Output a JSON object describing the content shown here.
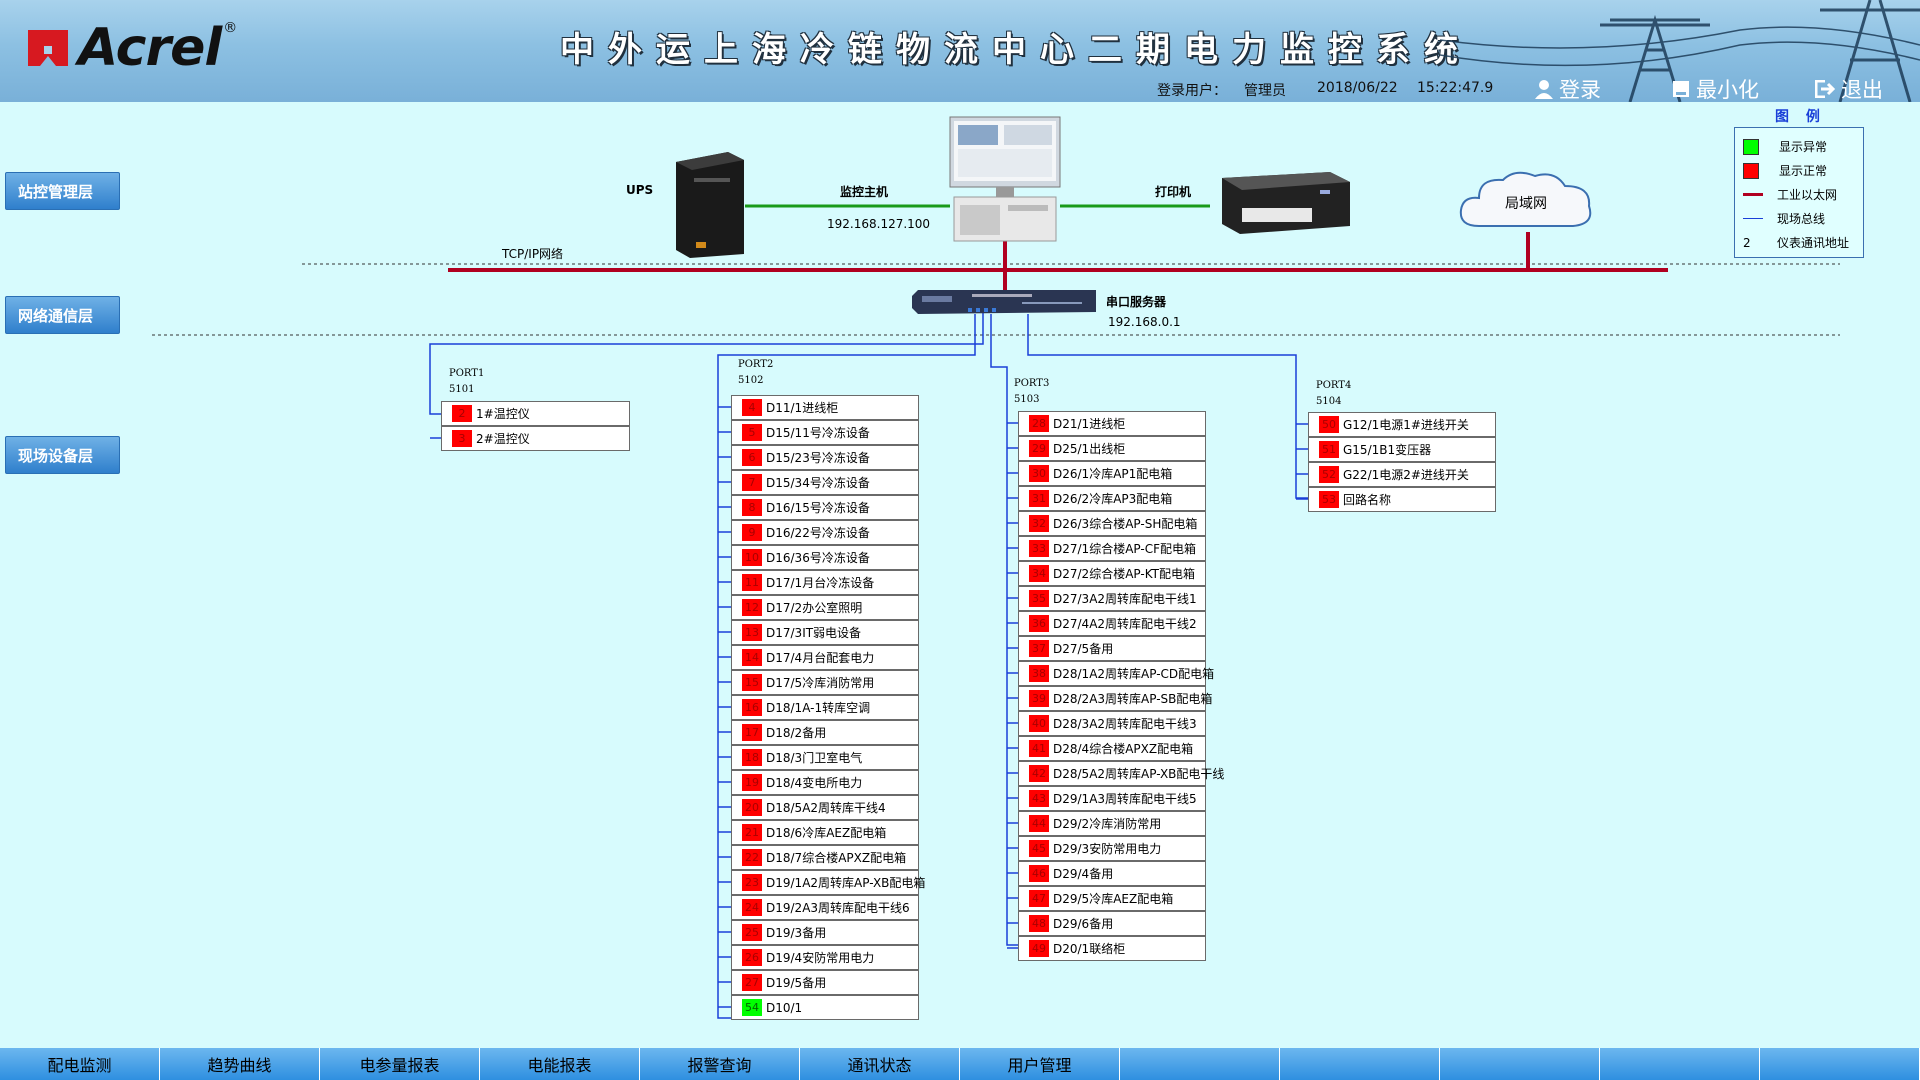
{
  "header": {
    "brand": "Acrel",
    "registered_mark": "®",
    "title": "中外运上海冷链物流中心二期电力监控系统",
    "login_user_label": "登录用户：",
    "user": "管理员",
    "date": "2018/06/22",
    "time": "15:22:47.9",
    "login_button": "登录",
    "minimize_button": "最小化",
    "exit_button": "退出"
  },
  "layers": {
    "station": "站控管理层",
    "network": "网络通信层",
    "field": "现场设备层"
  },
  "devices": {
    "ups": "UPS",
    "host": "监控主机",
    "host_ip": "192.168.127.100",
    "printer": "打印机",
    "lan": "局域网",
    "tcpip": "TCP/IP网络",
    "serial_server": "串口服务器",
    "serial_ip": "192.168.0.1"
  },
  "legend": {
    "title": "图 例",
    "items": [
      {
        "type": "green",
        "label": "显示异常"
      },
      {
        "type": "red",
        "label": "显示正常"
      },
      {
        "type": "ethernet",
        "label": "工业以太网"
      },
      {
        "type": "fieldbus",
        "label": "现场总线"
      },
      {
        "type": "addr",
        "symbol": "2",
        "label": "仪表通讯地址"
      }
    ]
  },
  "ports": [
    {
      "name": "PORT1",
      "num": "5101",
      "rows": [
        {
          "addr": "2",
          "name": "1#温控仪"
        },
        {
          "addr": "3",
          "name": "2#温控仪"
        }
      ]
    },
    {
      "name": "PORT2",
      "num": "5102",
      "rows": [
        {
          "addr": "4",
          "name": "D11/1进线柜"
        },
        {
          "addr": "5",
          "name": "D15/11号冷冻设备"
        },
        {
          "addr": "6",
          "name": "D15/23号冷冻设备"
        },
        {
          "addr": "7",
          "name": "D15/34号冷冻设备"
        },
        {
          "addr": "8",
          "name": "D16/15号冷冻设备"
        },
        {
          "addr": "9",
          "name": "D16/22号冷冻设备"
        },
        {
          "addr": "10",
          "name": "D16/36号冷冻设备"
        },
        {
          "addr": "11",
          "name": "D17/1月台冷冻设备"
        },
        {
          "addr": "12",
          "name": "D17/2办公室照明"
        },
        {
          "addr": "13",
          "name": "D17/3IT弱电设备"
        },
        {
          "addr": "14",
          "name": "D17/4月台配套电力"
        },
        {
          "addr": "15",
          "name": "D17/5冷库消防常用"
        },
        {
          "addr": "16",
          "name": "D18/1A-1转库空调"
        },
        {
          "addr": "17",
          "name": "D18/2备用"
        },
        {
          "addr": "18",
          "name": "D18/3门卫室电气"
        },
        {
          "addr": "19",
          "name": "D18/4变电所电力"
        },
        {
          "addr": "20",
          "name": "D18/5A2周转库干线4"
        },
        {
          "addr": "21",
          "name": "D18/6冷库AEZ配电箱"
        },
        {
          "addr": "22",
          "name": "D18/7综合楼APXZ配电箱"
        },
        {
          "addr": "23",
          "name": "D19/1A2周转库AP-XB配电箱"
        },
        {
          "addr": "24",
          "name": "D19/2A3周转库配电干线6"
        },
        {
          "addr": "25",
          "name": "D19/3备用"
        },
        {
          "addr": "26",
          "name": "D19/4安防常用电力"
        },
        {
          "addr": "27",
          "name": "D19/5备用"
        },
        {
          "addr": "54",
          "name": "D10/1",
          "status": "green"
        }
      ]
    },
    {
      "name": "PORT3",
      "num": "5103",
      "rows": [
        {
          "addr": "28",
          "name": "D21/1进线柜"
        },
        {
          "addr": "29",
          "name": "D25/1出线柜"
        },
        {
          "addr": "30",
          "name": "D26/1冷库AP1配电箱"
        },
        {
          "addr": "31",
          "name": "D26/2冷库AP3配电箱"
        },
        {
          "addr": "32",
          "name": "D26/3综合楼AP-SH配电箱"
        },
        {
          "addr": "33",
          "name": "D27/1综合楼AP-CF配电箱"
        },
        {
          "addr": "34",
          "name": "D27/2综合楼AP-KT配电箱"
        },
        {
          "addr": "35",
          "name": "D27/3A2周转库配电干线1"
        },
        {
          "addr": "36",
          "name": "D27/4A2周转库配电干线2"
        },
        {
          "addr": "37",
          "name": "D27/5备用"
        },
        {
          "addr": "38",
          "name": "D28/1A2周转库AP-CD配电箱"
        },
        {
          "addr": "39",
          "name": "D28/2A3周转库AP-SB配电箱"
        },
        {
          "addr": "40",
          "name": "D28/3A2周转库配电干线3"
        },
        {
          "addr": "41",
          "name": "D28/4综合楼APXZ配电箱"
        },
        {
          "addr": "42",
          "name": "D28/5A2周转库AP-XB配电干线"
        },
        {
          "addr": "43",
          "name": "D29/1A3周转库配电干线5"
        },
        {
          "addr": "44",
          "name": "D29/2冷库消防常用"
        },
        {
          "addr": "45",
          "name": "D29/3安防常用电力"
        },
        {
          "addr": "46",
          "name": "D29/4备用"
        },
        {
          "addr": "47",
          "name": "D29/5冷库AEZ配电箱"
        },
        {
          "addr": "48",
          "name": "D29/6备用"
        },
        {
          "addr": "49",
          "name": "D20/1联络柜"
        }
      ]
    },
    {
      "name": "PORT4",
      "num": "5104",
      "rows": [
        {
          "addr": "50",
          "name": "G12/1电源1#进线开关"
        },
        {
          "addr": "51",
          "name": "G15/1B1变压器"
        },
        {
          "addr": "52",
          "name": "G22/1电源2#进线开关"
        },
        {
          "addr": "53",
          "name": "回路名称"
        }
      ]
    }
  ],
  "nav": [
    "配电监测",
    "趋势曲线",
    "电参量报表",
    "电能报表",
    "报警查询",
    "通讯状态",
    "用户管理",
    "",
    "",
    "",
    "",
    ""
  ],
  "colors": {
    "background": "#d7fbfd",
    "status_normal": "#ff0000",
    "status_abnormal": "#00ff00",
    "ethernet": "#b00020",
    "fieldbus": "#1a3fd8"
  }
}
